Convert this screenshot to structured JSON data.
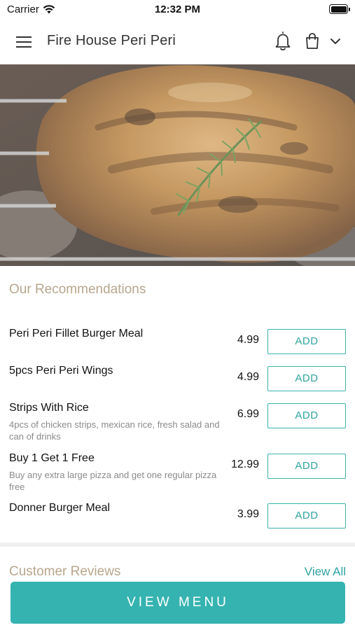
{
  "status_bar": {
    "carrier": "Carrier",
    "time": "12:32 PM"
  },
  "header": {
    "title": "Fire House Peri Peri",
    "icons": [
      "menu-icon",
      "bell-icon",
      "shopping-bag-icon",
      "chevron-down-icon"
    ]
  },
  "recommendations": {
    "title": "Our Recommendations",
    "add_label": "ADD",
    "items": [
      {
        "name": "Peri Peri Fillet Burger Meal",
        "description": "",
        "price": "4.99"
      },
      {
        "name": "5pcs Peri Peri Wings",
        "description": "",
        "price": "4.99"
      },
      {
        "name": "Strips With Rice",
        "description": "4pcs of chicken strips, mexican rice, fresh salad and can of drinks",
        "price": "6.99"
      },
      {
        "name": "Buy 1 Get 1 Free",
        "description": "Buy any extra large pizza and get one regular pizza free",
        "price": "12.99"
      },
      {
        "name": "Donner Burger Meal",
        "description": "",
        "price": "3.99"
      }
    ]
  },
  "reviews": {
    "title": "Customer Reviews",
    "view_all": "View All"
  },
  "footer": {
    "view_menu": "VIEW MENU"
  },
  "colors": {
    "accent": "#35b3b0",
    "section_title": "#b7a68c",
    "description": "#8a8a8a"
  }
}
